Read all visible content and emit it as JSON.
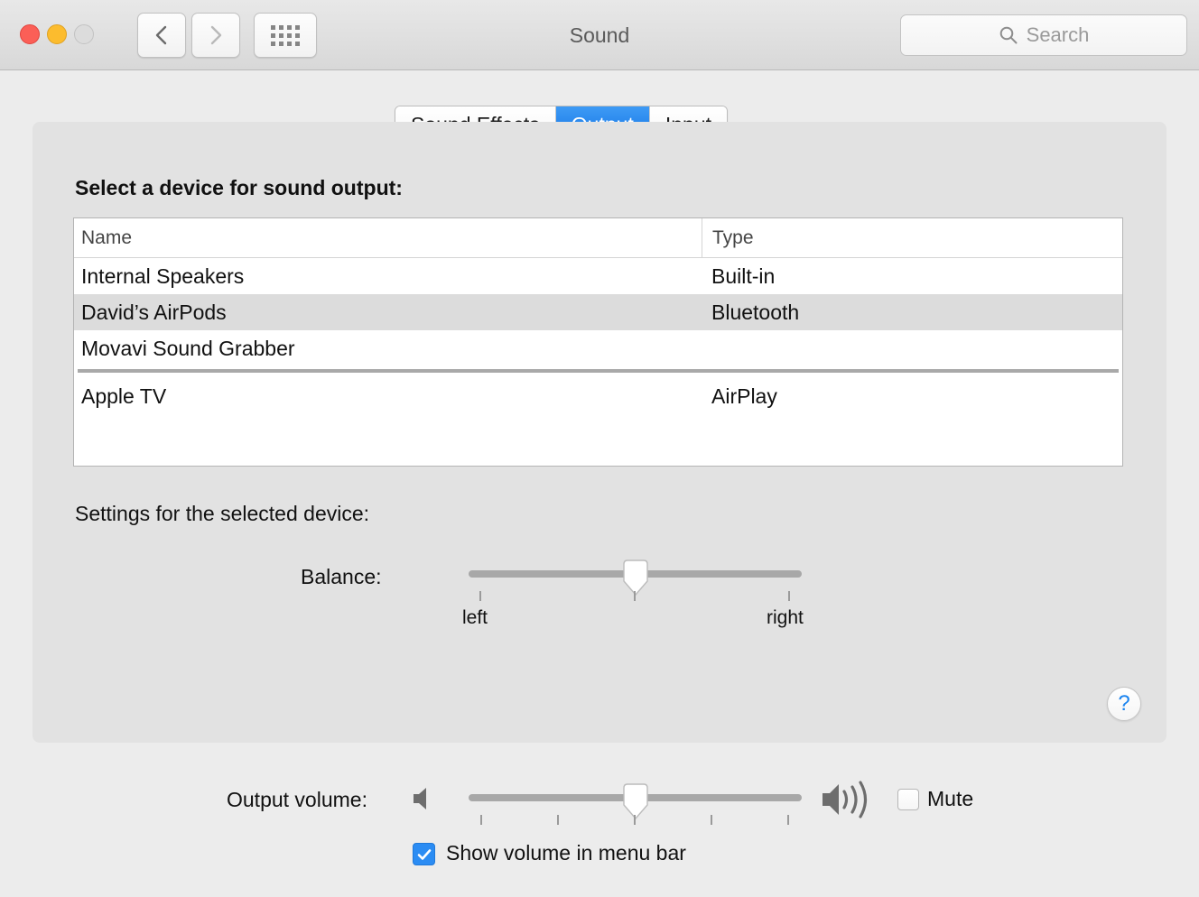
{
  "window": {
    "title": "Sound",
    "traffic_lights": [
      "close",
      "minimize",
      "zoom"
    ],
    "back_icon": "chevron-left-icon",
    "forward_icon": "chevron-right-icon",
    "grid_icon": "show-all-grid-icon"
  },
  "search": {
    "placeholder": "Search",
    "value": "",
    "icon": "search-icon"
  },
  "tabs": [
    {
      "label": "Sound Effects",
      "active": false
    },
    {
      "label": "Output",
      "active": true
    },
    {
      "label": "Input",
      "active": false
    }
  ],
  "main": {
    "heading": "Select a device for sound output:",
    "table": {
      "columns": [
        "Name",
        "Type"
      ],
      "rows": [
        {
          "name": "Internal Speakers",
          "type": "Built-in",
          "selected": false
        },
        {
          "name": "David’s AirPods",
          "type": "Bluetooth",
          "selected": true
        },
        {
          "name": "Movavi Sound Grabber",
          "type": "",
          "selected": false
        },
        {
          "name": "Apple TV",
          "type": "AirPlay",
          "selected": false
        }
      ],
      "separator_after_row": 3
    },
    "settings_label": "Settings for the selected device:",
    "balance": {
      "label": "Balance:",
      "left_label": "left",
      "right_label": "right",
      "value": 50,
      "min": 0,
      "max": 100,
      "ticks": 3
    },
    "help_button": {
      "glyph": "?",
      "icon": "help-icon",
      "color": "#1a84f0"
    }
  },
  "bottom": {
    "output_volume_label": "Output volume:",
    "volume": {
      "value": 50,
      "min": 0,
      "max": 100,
      "ticks": 5
    },
    "low_volume_icon": "speaker-mute-icon",
    "high_volume_icon": "speaker-loud-icon",
    "mute": {
      "label": "Mute",
      "checked": false
    },
    "show_volume": {
      "label": "Show volume in menu bar",
      "checked": true
    }
  },
  "colors": {
    "accent": "#1272e4",
    "panel": "#e2e2e2",
    "window": "#ececec",
    "selection": "#dcdcdc",
    "checkbox_on": "#2b8cf3"
  }
}
